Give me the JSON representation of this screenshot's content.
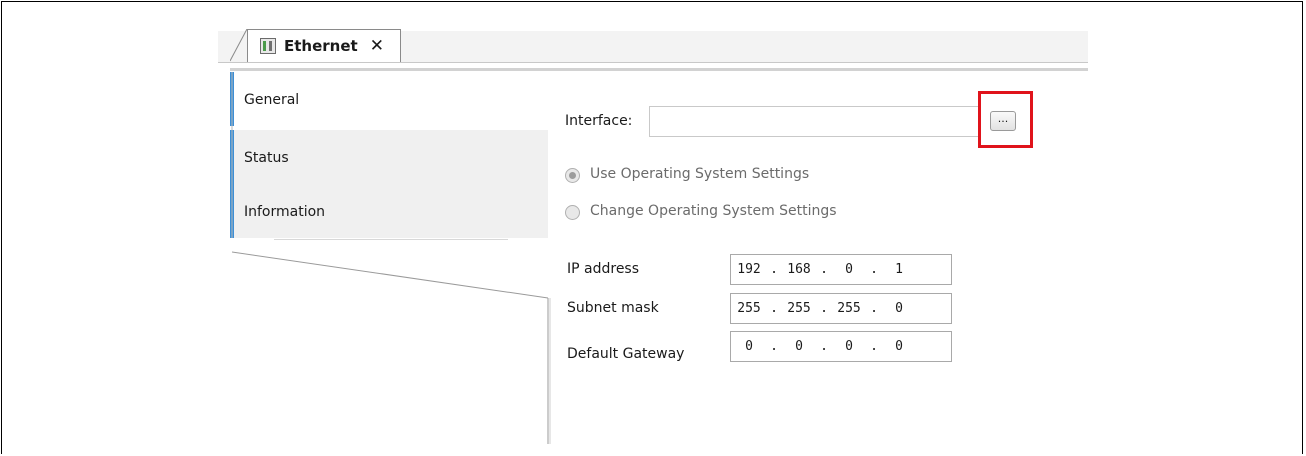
{
  "tab": {
    "label": "Ethernet",
    "close": "✕",
    "icon": "device-icon"
  },
  "nav": [
    {
      "label": "General"
    },
    {
      "label": "Status"
    },
    {
      "label": "Information"
    }
  ],
  "general": {
    "interface_label": "Interface:",
    "interface_value": "",
    "browse_label": "...",
    "radio_use_os": "Use Operating System Settings",
    "radio_change_os": "Change Operating System Settings",
    "ip_label": "IP address",
    "ip": [
      "192",
      "168",
      "0",
      "1"
    ],
    "subnet_label": "Subnet mask",
    "subnet": [
      "255",
      "255",
      "255",
      "0"
    ],
    "gateway_label": "Default Gateway",
    "gateway": [
      "0",
      "0",
      "0",
      "0"
    ]
  },
  "colors": {
    "highlight": "#e0131b",
    "nav_accent": "#3d8fd6"
  }
}
